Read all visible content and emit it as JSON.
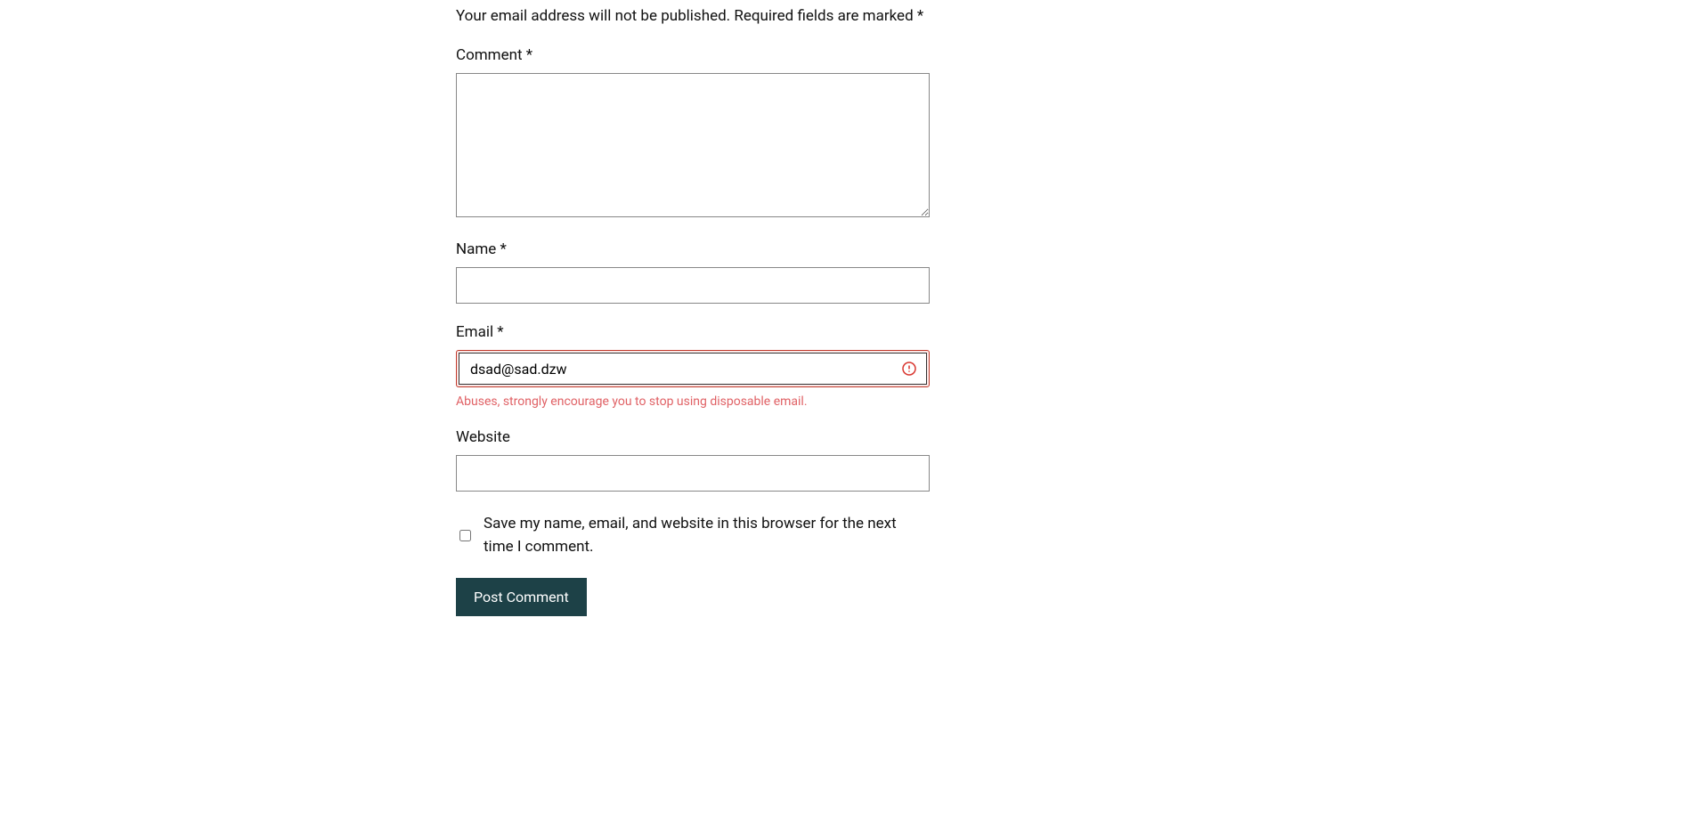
{
  "form": {
    "notice": "Your email address will not be published. Required fields are marked *",
    "comment": {
      "label": "Comment *",
      "value": ""
    },
    "name": {
      "label": "Name *",
      "value": ""
    },
    "email": {
      "label": "Email *",
      "value": "dsad@sad.dzw",
      "error": "Abuses, strongly encourage you to stop using disposable email."
    },
    "website": {
      "label": "Website",
      "value": ""
    },
    "save_cookies": {
      "label": "Save my name, email, and website in this browser for the next time I comment.",
      "checked": false
    },
    "submit_label": "Post Comment"
  }
}
